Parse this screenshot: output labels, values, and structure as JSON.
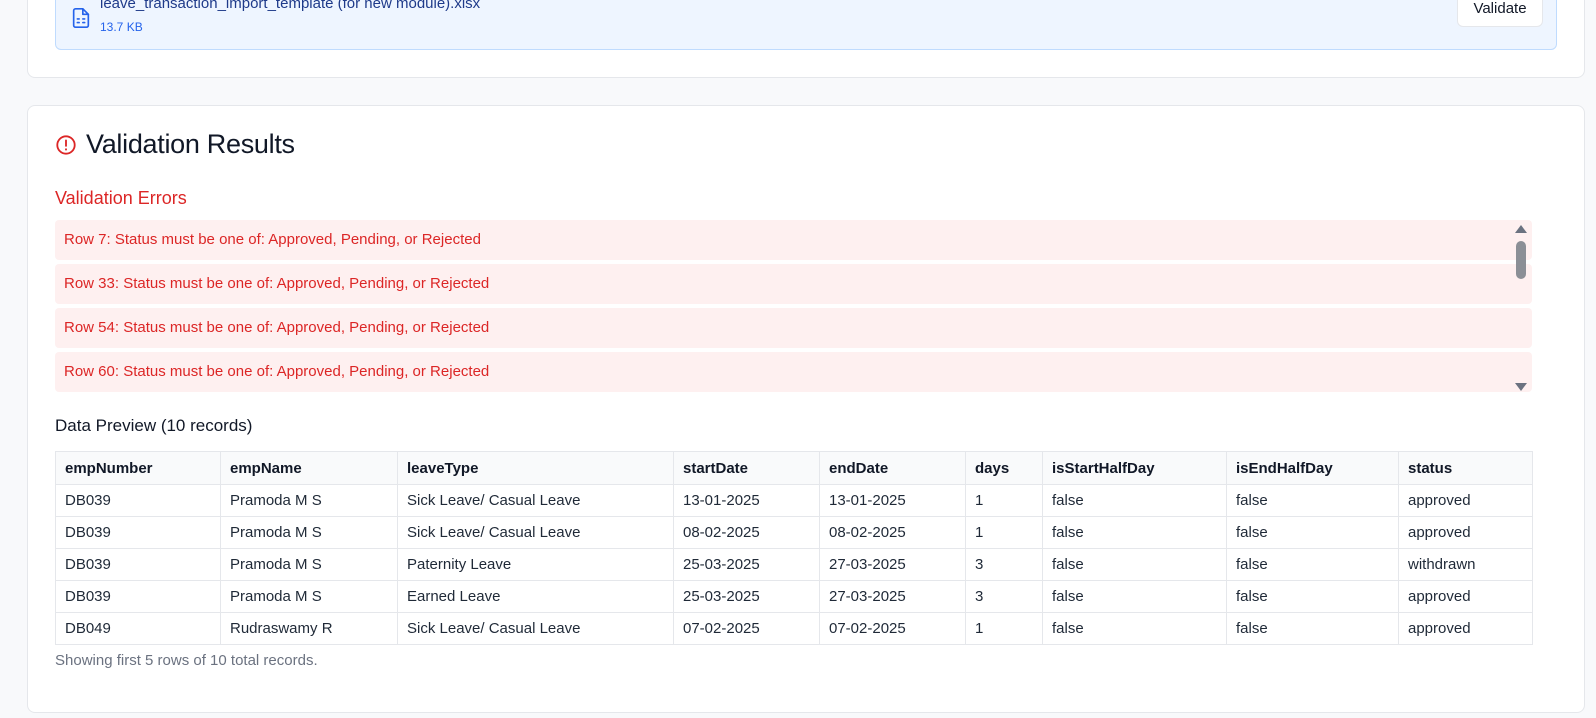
{
  "upload": {
    "file_name": "leave_transaction_import_template (for new module).xlsx",
    "file_size": "13.7 KB",
    "validate_label": "Validate",
    "file_icon": "file-spreadsheet-icon"
  },
  "results": {
    "title": "Validation Results",
    "alert_icon": "alert-circle-icon",
    "errors_title": "Validation Errors",
    "errors": [
      "Row 7: Status must be one of: Approved, Pending, or Rejected",
      "Row 33: Status must be one of: Approved, Pending, or Rejected",
      "Row 54: Status must be one of: Approved, Pending, or Rejected",
      "Row 60: Status must be one of: Approved, Pending, or Rejected"
    ],
    "preview_title": "Data Preview (10 records)",
    "columns": [
      "empNumber",
      "empName",
      "leaveType",
      "startDate",
      "endDate",
      "days",
      "isStartHalfDay",
      "isEndHalfDay",
      "status"
    ],
    "rows": [
      [
        "DB039",
        "Pramoda M S",
        "Sick Leave/ Casual Leave",
        "13-01-2025",
        "13-01-2025",
        "1",
        "false",
        "false",
        "approved"
      ],
      [
        "DB039",
        "Pramoda M S",
        "Sick Leave/ Casual Leave",
        "08-02-2025",
        "08-02-2025",
        "1",
        "false",
        "false",
        "approved"
      ],
      [
        "DB039",
        "Pramoda M S",
        "Paternity Leave",
        "25-03-2025",
        "27-03-2025",
        "3",
        "false",
        "false",
        "withdrawn"
      ],
      [
        "DB039",
        "Pramoda M S",
        "Earned Leave",
        "25-03-2025",
        "27-03-2025",
        "3",
        "false",
        "false",
        "approved"
      ],
      [
        "DB049",
        "Rudraswamy R",
        "Sick Leave/ Casual Leave",
        "07-02-2025",
        "07-02-2025",
        "1",
        "false",
        "false",
        "approved"
      ]
    ],
    "footer_note": "Showing first 5 rows of 10 total records."
  },
  "colors": {
    "error": "#dc2626",
    "error_bg": "#fef0f0",
    "file_bg": "#eef5ff",
    "file_text": "#1e3a8a"
  }
}
